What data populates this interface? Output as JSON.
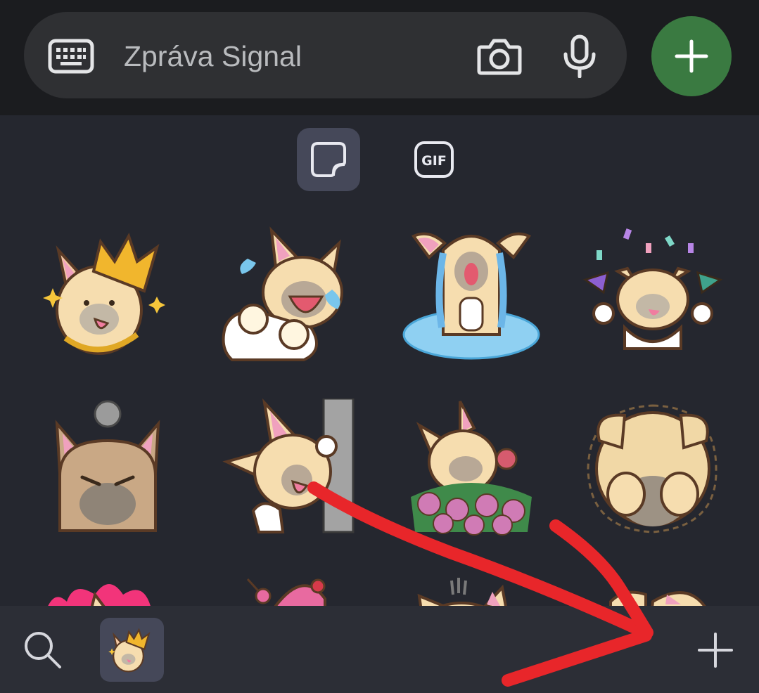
{
  "composer": {
    "placeholder": "Zpráva Signal",
    "keyboard_icon": "keyboard-icon",
    "camera_icon": "camera-icon",
    "mic_icon": "microphone-icon",
    "attach_icon": "plus-icon"
  },
  "tabs": [
    {
      "name": "stickers",
      "icon": "sticker-icon",
      "selected": true
    },
    {
      "name": "gif",
      "icon": "gif-icon",
      "label": "GIF",
      "selected": false
    }
  ],
  "stickers": [
    "crowned-dog",
    "crying-dog",
    "puddle-crying-dog",
    "party-dog",
    "angry-dog",
    "peeking-dog",
    "flower-dog",
    "covering-eyes-dog",
    "fire-dog",
    "cake-dog",
    "stressed-dog",
    "dog-partial"
  ],
  "bottombar": {
    "search_icon": "search-icon",
    "pack_icon": "crowned-dog-pack-icon",
    "add_icon": "plus-icon"
  },
  "colors": {
    "accent": "#3a7a41",
    "panel": "#25272f",
    "selected_tab": "#454859",
    "annotation": "#e8262a"
  }
}
